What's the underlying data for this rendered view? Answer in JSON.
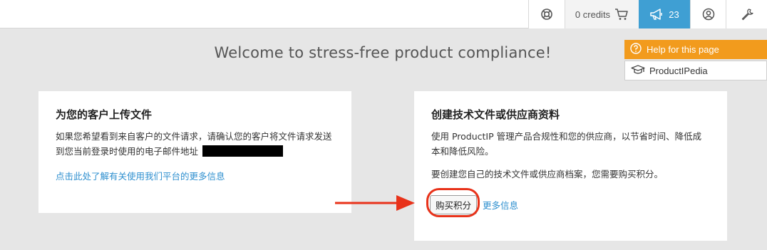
{
  "topbar": {
    "credits_label": "0 credits",
    "news_count": "23",
    "icons": [
      "lifebuoy-icon",
      "cart-icon",
      "megaphone-icon",
      "user-icon",
      "wrench-icon"
    ]
  },
  "help": {
    "help_label": "Help for this page",
    "pedia_label": "ProductIPedia"
  },
  "main": {
    "title": "Welcome to stress-free product compliance!"
  },
  "left_card": {
    "heading": "为您的客户上传文件",
    "text": "如果您希望看到来自客户的文件请求，请确认您的客户将文件请求发送到您当前登录时使用的电子邮件地址",
    "link": "点击此处了解有关使用我们平台的更多信息"
  },
  "right_card": {
    "heading": "创建技术文件或供应商资料",
    "text": "使用 ProductIP 管理产品合规性和您的供应商，以节省时间、降低成本和降低风险。",
    "text2": "要创建您自己的技术文件或供应商档案，您需要购买积分。",
    "buy_button": "购买积分",
    "more_link": "更多信息"
  },
  "colors": {
    "accent_blue": "#3f9fd3",
    "help_orange": "#f29b1d",
    "annotation_red": "#e8321a",
    "link": "#2e8fcf"
  }
}
